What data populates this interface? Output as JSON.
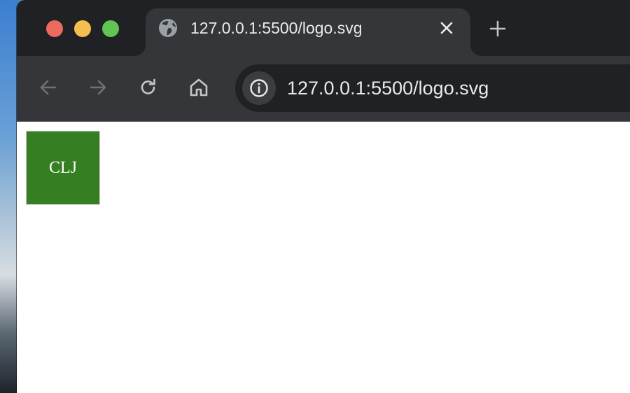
{
  "browser": {
    "tab": {
      "title": "127.0.0.1:5500/logo.svg",
      "favicon": "globe-icon"
    },
    "omnibox": {
      "url": "127.0.0.1:5500/logo.svg",
      "site_info_icon": "info-icon"
    },
    "nav": {
      "back_icon": "arrow-left-icon",
      "forward_icon": "arrow-right-icon",
      "reload_icon": "reload-icon",
      "home_icon": "home-icon"
    },
    "colors": {
      "tabstrip": "#202124",
      "toolbar": "#35363a",
      "close": "#ed6a5e",
      "minimize": "#f5bf4f",
      "maximize": "#61c554"
    }
  },
  "page": {
    "logo": {
      "text": "CLJ",
      "background": "#367e22",
      "text_color": "#ffffff"
    }
  }
}
